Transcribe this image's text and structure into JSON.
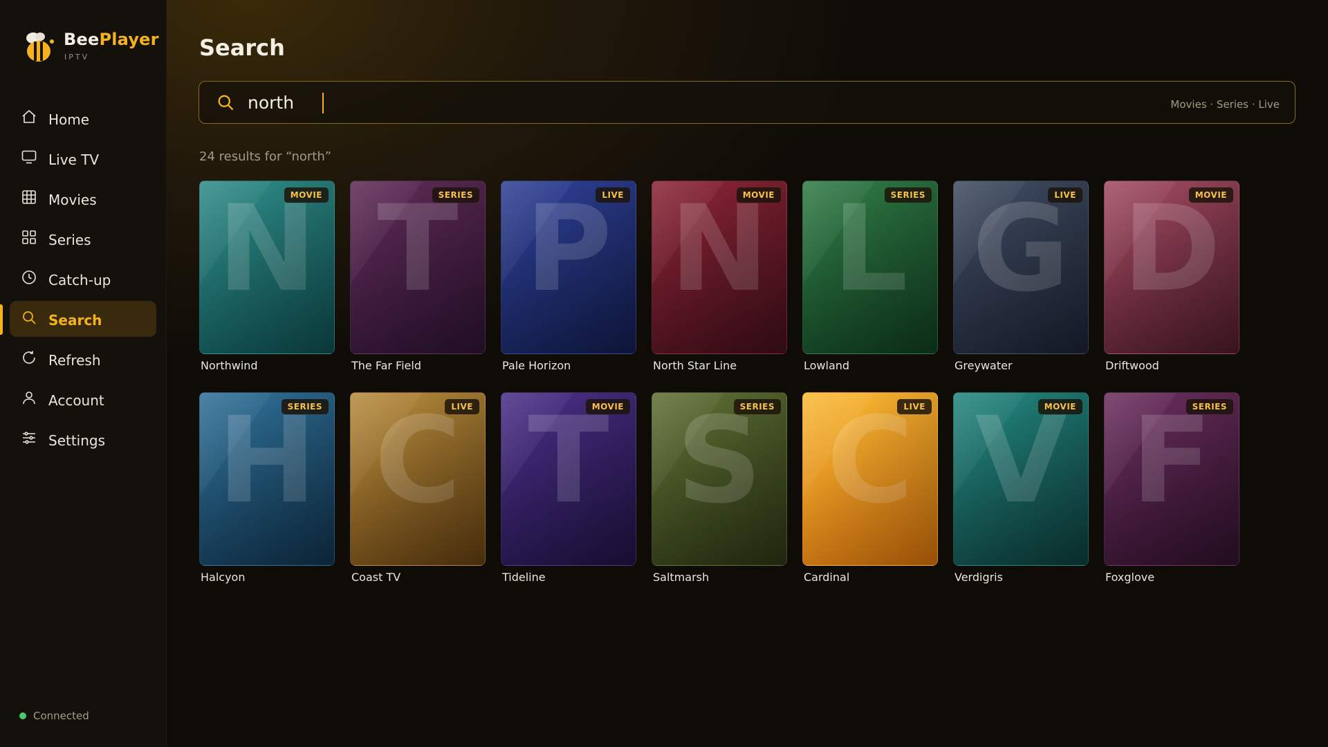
{
  "app": {
    "brand_part1": "Bee",
    "brand_part2": "Player",
    "brand_sub": "IPTV",
    "accent": "#f6b21c"
  },
  "sidebar": {
    "items": [
      {
        "label": "Home",
        "icon": "home-icon"
      },
      {
        "label": "Live TV",
        "icon": "tv-icon"
      },
      {
        "label": "Movies",
        "icon": "film-grid-icon"
      },
      {
        "label": "Series",
        "icon": "grid-squares-icon"
      },
      {
        "label": "Catch-up",
        "icon": "clock-icon"
      },
      {
        "label": "Search",
        "icon": "search-icon",
        "active": true
      },
      {
        "label": "Refresh",
        "icon": "refresh-icon"
      },
      {
        "label": "Account",
        "icon": "user-icon"
      },
      {
        "label": "Settings",
        "icon": "sliders-icon"
      }
    ],
    "status": {
      "label": "Connected",
      "color": "#4ec76a"
    }
  },
  "main": {
    "title": "Search",
    "search": {
      "value": "north",
      "filters": "Movies · Series · Live"
    },
    "results_text": "24 results for “north”",
    "cards": [
      {
        "title": "Northwind",
        "type": "MOVIE",
        "letter": "N",
        "colors": [
          "#2e8a86",
          "#0e4a4c"
        ]
      },
      {
        "title": "The Far Field",
        "type": "SERIES",
        "letter": "T",
        "colors": [
          "#5e2a55",
          "#2a1230"
        ]
      },
      {
        "title": "Pale Horizon",
        "type": "LIVE",
        "letter": "P",
        "colors": [
          "#2e3f94",
          "#121c4a"
        ]
      },
      {
        "title": "North Star Line",
        "type": "MOVIE",
        "letter": "N",
        "colors": [
          "#8a2436",
          "#3e0e18"
        ]
      },
      {
        "title": "Lowland",
        "type": "SERIES",
        "letter": "L",
        "colors": [
          "#2f7a45",
          "#0f3a1e"
        ]
      },
      {
        "title": "Greywater",
        "type": "LIVE",
        "letter": "G",
        "colors": [
          "#3f4b60",
          "#1a2030"
        ]
      },
      {
        "title": "Driftwood",
        "type": "MOVIE",
        "letter": "D",
        "colors": [
          "#a04a60",
          "#4a1a28"
        ]
      },
      {
        "title": "Halcyon",
        "type": "SERIES",
        "letter": "H",
        "colors": [
          "#2f6f96",
          "#0f3048"
        ]
      },
      {
        "title": "Coast TV",
        "type": "LIVE",
        "letter": "C",
        "colors": [
          "#b58a3c",
          "#5e3c10"
        ]
      },
      {
        "title": "Tideline",
        "type": "MOVIE",
        "letter": "T",
        "colors": [
          "#4a2e86",
          "#1e1240"
        ]
      },
      {
        "title": "Saltmarsh",
        "type": "SERIES",
        "letter": "S",
        "colors": [
          "#5e6e34",
          "#283212"
        ]
      },
      {
        "title": "Cardinal",
        "type": "LIVE",
        "letter": "C",
        "colors": [
          "#f9b935",
          "#c86a0a"
        ]
      },
      {
        "title": "Verdigris",
        "type": "MOVIE",
        "letter": "V",
        "colors": [
          "#23857e",
          "#0c3a38"
        ]
      },
      {
        "title": "Foxglove",
        "type": "SERIES",
        "letter": "F",
        "colors": [
          "#6a2e5e",
          "#2c1028"
        ]
      }
    ]
  }
}
